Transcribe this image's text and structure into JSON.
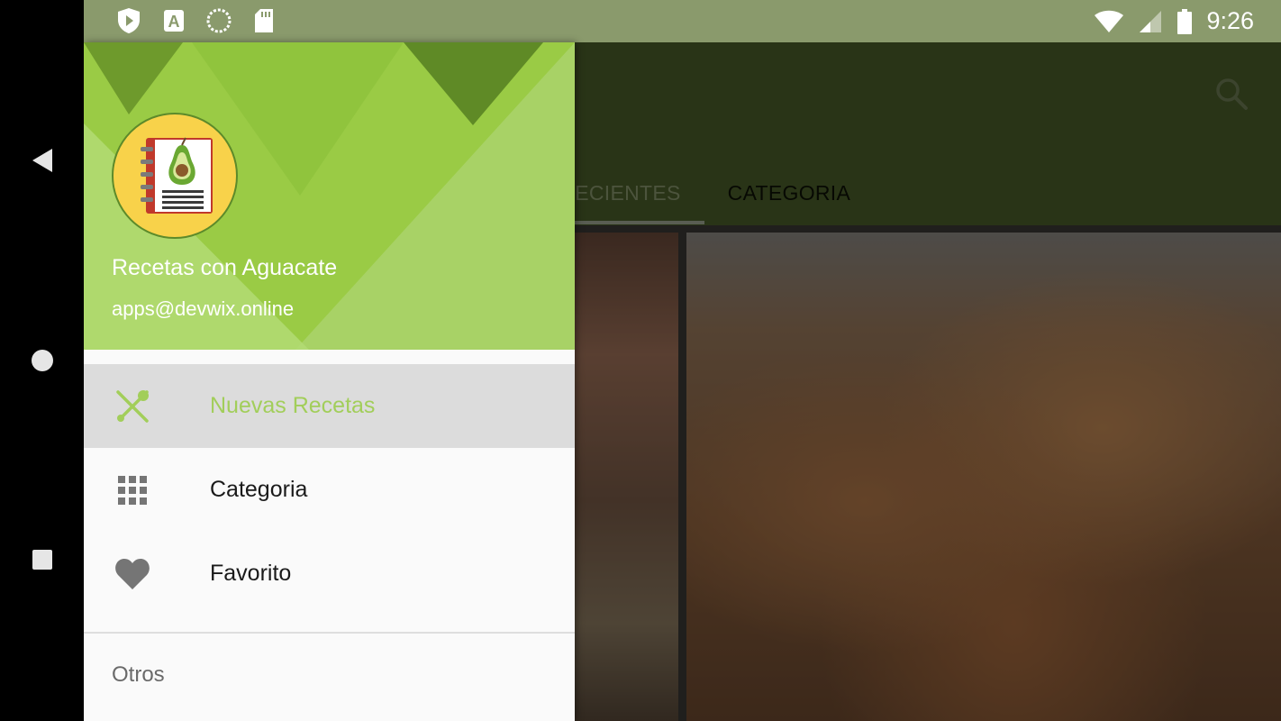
{
  "statusbar": {
    "left_icons": [
      "play-protect-icon",
      "font-a-icon",
      "sync-circle-icon",
      "sd-card-icon"
    ],
    "right_icons": [
      "wifi-icon",
      "cell-signal-icon",
      "battery-icon"
    ],
    "time": "9:26"
  },
  "appbar": {
    "tabs": [
      {
        "label": "S RECIENTES",
        "selected": true
      },
      {
        "label": "CATEGORIA",
        "selected": false
      }
    ],
    "search_icon": "search-icon"
  },
  "drawer": {
    "app_name": "Recetas con Aguacate",
    "email": "apps@devwix.online",
    "items": [
      {
        "label": "Nuevas Recetas",
        "icon": "fork-spoon-icon",
        "active": true
      },
      {
        "label": "Categoria",
        "icon": "grid-icon",
        "active": false
      },
      {
        "label": "Favorito",
        "icon": "heart-icon",
        "active": false
      }
    ],
    "section_label": "Otros"
  },
  "colors": {
    "accent": "#9acb45",
    "active_text": "#a2ce5a",
    "appbar": "#4c5f2a"
  },
  "navbar": {
    "buttons": [
      "back-icon",
      "home-icon",
      "recents-icon"
    ]
  }
}
